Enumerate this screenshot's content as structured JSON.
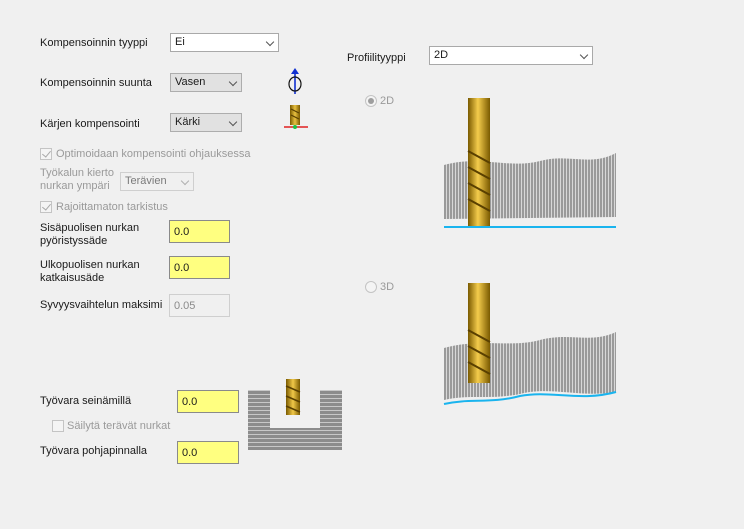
{
  "compensation": {
    "type_label": "Kompensoinnin tyyppi",
    "type_value": "Ei",
    "direction_label": "Kompensoinnin suunta",
    "direction_value": "Vasen",
    "tip_label": "Kärjen kompensointi",
    "tip_value": "Kärki",
    "optimize_label": "Optimoidaan kompensointi ohjauksessa",
    "optimize_checked": true,
    "corner_rotation_label_line1": "Työkalun kierto",
    "corner_rotation_label_line2": "nurkan ympäri",
    "corner_rotation_value": "Terävien",
    "unlimited_check_label": "Rajoittamaton tarkistus",
    "unlimited_checked": true,
    "inner_radius_label_line1": "Sisäpuolisen nurkan",
    "inner_radius_label_line2": "pyöristyssäde",
    "inner_radius_value": "0.0",
    "outer_chamfer_label_line1": "Ulkopuolisen nurkan",
    "outer_chamfer_label_line2": "katkaisusäde",
    "outer_chamfer_value": "0.0",
    "depth_variation_label": "Syvyysvaihtelun maksimi",
    "depth_variation_value": "0.05"
  },
  "stock": {
    "wall_label": "Työvara seinämillä",
    "wall_value": "0.0",
    "sharp_corners_label": "Säilytä terävät nurkat",
    "sharp_corners_checked": false,
    "floor_label": "Työvara pohjapinnalla",
    "floor_value": "0.0"
  },
  "profile": {
    "type_label": "Profiilityyppi",
    "type_value": "2D",
    "option_2d": "2D",
    "option_3d": "3D",
    "selected": "2D"
  },
  "colors": {
    "input_highlight": "#ffff80",
    "tool_gold": "#d4a017",
    "contour_blue": "#1ab4ee",
    "axis_red": "#e02020",
    "axis_green": "#20c040",
    "axis_blue": "#1030d0"
  }
}
